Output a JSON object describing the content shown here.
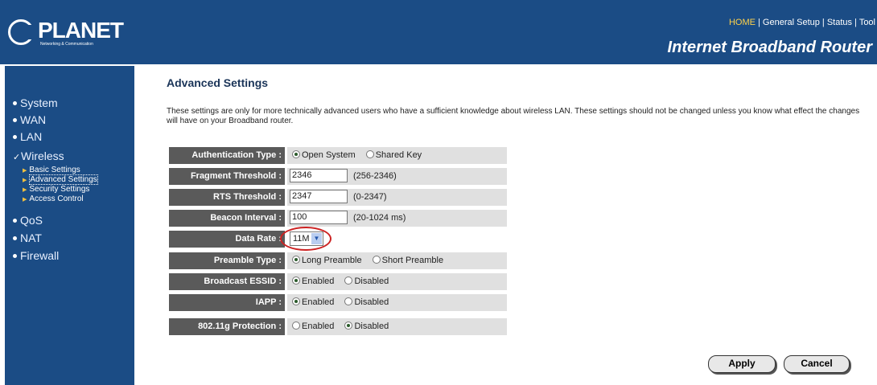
{
  "header": {
    "logo_text": "PLANET",
    "logo_sub": "Networking & Communication",
    "topnav": [
      "HOME",
      "General Setup",
      "Status",
      "Tool"
    ],
    "brand": "Internet Broadband Router"
  },
  "sidebar": {
    "items": [
      {
        "label": "System"
      },
      {
        "label": "WAN"
      },
      {
        "label": "LAN"
      },
      {
        "label": "Wireless"
      },
      {
        "label": "QoS"
      },
      {
        "label": "NAT"
      },
      {
        "label": "Firewall"
      }
    ],
    "wireless_sub": [
      {
        "label": "Basic Settings"
      },
      {
        "label": "Advanced Settings"
      },
      {
        "label": "Security Settings"
      },
      {
        "label": "Access Control"
      }
    ]
  },
  "page": {
    "title": "Advanced Settings",
    "description": "These settings are only for more technically advanced users who have a sufficient knowledge about wireless LAN. These settings should not be changed unless you know what effect the changes will have on your Broadband router."
  },
  "form": {
    "auth": {
      "label": "Authentication Type :",
      "opt1": "Open System",
      "opt2": "Shared Key"
    },
    "frag": {
      "label": "Fragment Threshold :",
      "value": "2346",
      "hint": "(256-2346)"
    },
    "rts": {
      "label": "RTS Threshold :",
      "value": "2347",
      "hint": "(0-2347)"
    },
    "beacon": {
      "label": "Beacon Interval :",
      "value": "100",
      "hint": "(20-1024 ms)"
    },
    "rate": {
      "label": "Data Rate :",
      "value": "11M"
    },
    "preamble": {
      "label": "Preamble Type :",
      "opt1": "Long Preamble",
      "opt2": "Short Preamble"
    },
    "essid": {
      "label": "Broadcast ESSID :",
      "opt1": "Enabled",
      "opt2": "Disabled"
    },
    "iapp": {
      "label": "IAPP :",
      "opt1": "Enabled",
      "opt2": "Disabled"
    },
    "prot": {
      "label": "802.11g Protection :",
      "opt1": "Enabled",
      "opt2": "Disabled"
    }
  },
  "buttons": {
    "apply": "Apply",
    "cancel": "Cancel"
  }
}
